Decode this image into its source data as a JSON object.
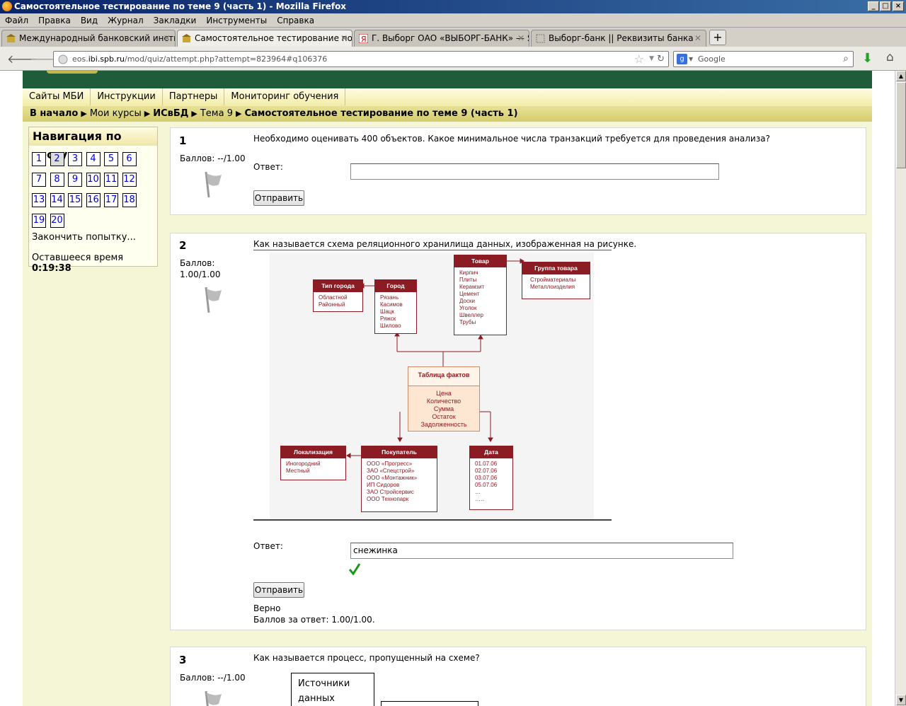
{
  "window": {
    "title": "Самостоятельное тестирование по теме 9 (часть 1) - Mozilla Firefox"
  },
  "menubar": [
    "Файл",
    "Правка",
    "Вид",
    "Журнал",
    "Закладки",
    "Инструменты",
    "Справка"
  ],
  "tabs": [
    {
      "label": "Международный банковский институт"
    },
    {
      "label": "Самостоятельное тестирование по те..."
    },
    {
      "label": "Г. Выборг ОАО «ВЫБОРГ-БАНК» — Янд..."
    },
    {
      "label": "Выборг-банк || Реквизиты банка"
    }
  ],
  "addressbar": {
    "host": "eos.ibi.spb.ru",
    "path": "/mod/quiz/attempt.php?attempt=823964#q106376",
    "prefix": "eos."
  },
  "searchbar": {
    "placeholder": "Google"
  },
  "site": {
    "topmenu": [
      "Сайты МБИ",
      "Инструкции",
      "Партнеры",
      "Мониторинг обучения"
    ],
    "breadcrumbs": [
      "В начало",
      "Мои курсы",
      "ИСвБД",
      "Тема 9",
      "Самостоятельное тестирование по теме 9 (часть 1)"
    ]
  },
  "quiznav": {
    "title": "Навигация по тесту",
    "buttons": [
      "1",
      "2",
      "3",
      "4",
      "5",
      "6",
      "7",
      "8",
      "9",
      "10",
      "11",
      "12",
      "13",
      "14",
      "15",
      "16",
      "17",
      "18",
      "19",
      "20"
    ],
    "current": "2",
    "finish_label": "Закончить попытку...",
    "time_label": "Оставшееся время",
    "time_value": "0:19:38"
  },
  "questions": [
    {
      "number": "1",
      "grade": "Баллов: --/1.00",
      "text": "Необходимо оценивать 400 объектов. Какое минимальное числа транзакций требуется для проведения анализа?",
      "answer_label": "Ответ:",
      "answer_value": "",
      "submit": "Отправить"
    },
    {
      "number": "2",
      "grade_line1": "Баллов:",
      "grade_line2": "1.00/1.00",
      "text": "Как называется схема реляционного хранилища данных, изображенная на рисунке.",
      "answer_label": "Ответ:",
      "answer_value": "снежинка",
      "submit": "Отправить",
      "feedback": "Верно",
      "mark": "Баллов за ответ: 1.00/1.00."
    },
    {
      "number": "3",
      "grade": "Баллов: --/1.00",
      "text": "Как называется процесс, пропущенный на схеме?",
      "diagram_box_line1": "Источники",
      "diagram_box_line2": "данных"
    }
  ],
  "diagram": {
    "tovar": {
      "title": "Товар",
      "items": [
        "Кирпич",
        "Плиты",
        "Керамзит",
        "Цемент",
        "Доски",
        "Уголок",
        "Швеллер",
        "Трубы"
      ]
    },
    "gruppa": {
      "title": "Группа товара",
      "items": [
        "Стройматериалы",
        "Металлоизделия"
      ]
    },
    "tip": {
      "title": "Тип города",
      "items": [
        "Областной",
        "Районный"
      ]
    },
    "gorod": {
      "title": "Город",
      "items": [
        "Рязань",
        "Касимов",
        "Шацк",
        "Ряжск",
        "Шилово"
      ]
    },
    "fact": {
      "title": "Таблица фактов",
      "items": [
        "Цена",
        "Количество",
        "Сумма",
        "Остаток",
        "Задолженность"
      ]
    },
    "lok": {
      "title": "Локализация",
      "items": [
        "Иногородний",
        "Местный"
      ]
    },
    "pokup": {
      "title": "Покупатель",
      "items": [
        "ООО «Прогресс»",
        "ЗАО «Спецстрой»",
        "ООО «Монтажник»",
        "ИП Сидоров",
        "ЗАО Стройсервис",
        "ООО Технопарк"
      ]
    },
    "data": {
      "title": "Дата",
      "items": [
        "01.07.06",
        "02.07.06",
        "03.07.06",
        "05.07.06",
        "…",
        "….."
      ]
    }
  },
  "colors": {
    "header": "#1f5c3a",
    "diagram_accent": "#8c1c24",
    "check": "#1a9a1a",
    "link": "#0000cc"
  }
}
